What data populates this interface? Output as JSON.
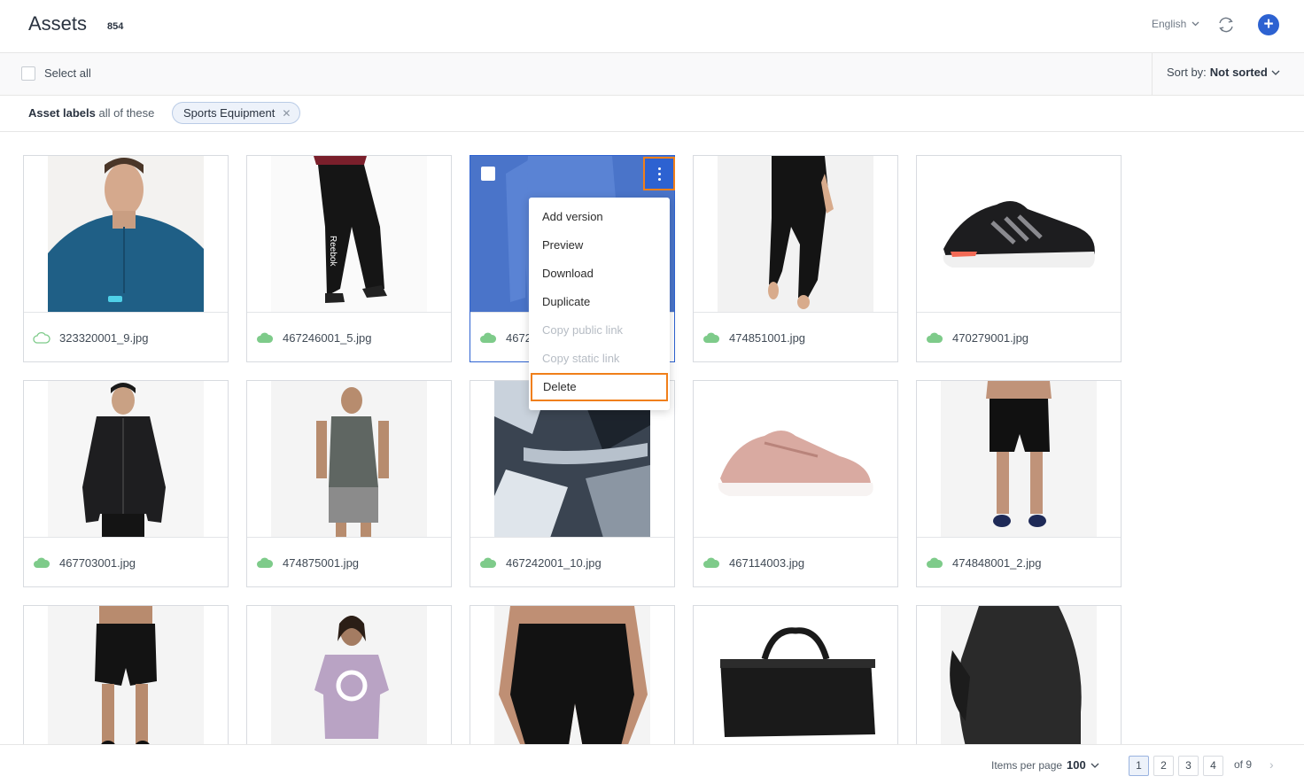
{
  "header": {
    "title": "Assets",
    "count": "854",
    "language": "English"
  },
  "toolbar": {
    "select_all": "Select all",
    "sort_label": "Sort by:",
    "sort_value": "Not sorted"
  },
  "filter": {
    "label_bold": "Asset labels",
    "label_rest": "all of these",
    "chip": "Sports Equipment"
  },
  "assets": [
    {
      "name": "323320001_9.jpg",
      "cloud": "outline"
    },
    {
      "name": "467246001_5.jpg",
      "cloud": "filled"
    },
    {
      "name": "467242001_1.jpg",
      "cloud": "filled"
    },
    {
      "name": "474851001.jpg",
      "cloud": "filled"
    },
    {
      "name": "470279001.jpg",
      "cloud": "filled"
    },
    {
      "name": "467703001.jpg",
      "cloud": "filled"
    },
    {
      "name": "474875001.jpg",
      "cloud": "filled"
    },
    {
      "name": "467242001_10.jpg",
      "cloud": "filled"
    },
    {
      "name": "467114003.jpg",
      "cloud": "filled"
    },
    {
      "name": "474848001_2.jpg",
      "cloud": "filled"
    }
  ],
  "menu": {
    "items": [
      "Add version",
      "Preview",
      "Download",
      "Duplicate",
      "Copy public link",
      "Copy static link",
      "Delete"
    ]
  },
  "footer": {
    "items_per_page_label": "Items per page",
    "items_per_page": "100",
    "pages": [
      "1",
      "2",
      "3",
      "4"
    ],
    "of_total": "of 9"
  },
  "colors": {
    "accent": "#2d62d1",
    "highlight": "#f07f1a",
    "cloud": "#7ecb8a"
  }
}
